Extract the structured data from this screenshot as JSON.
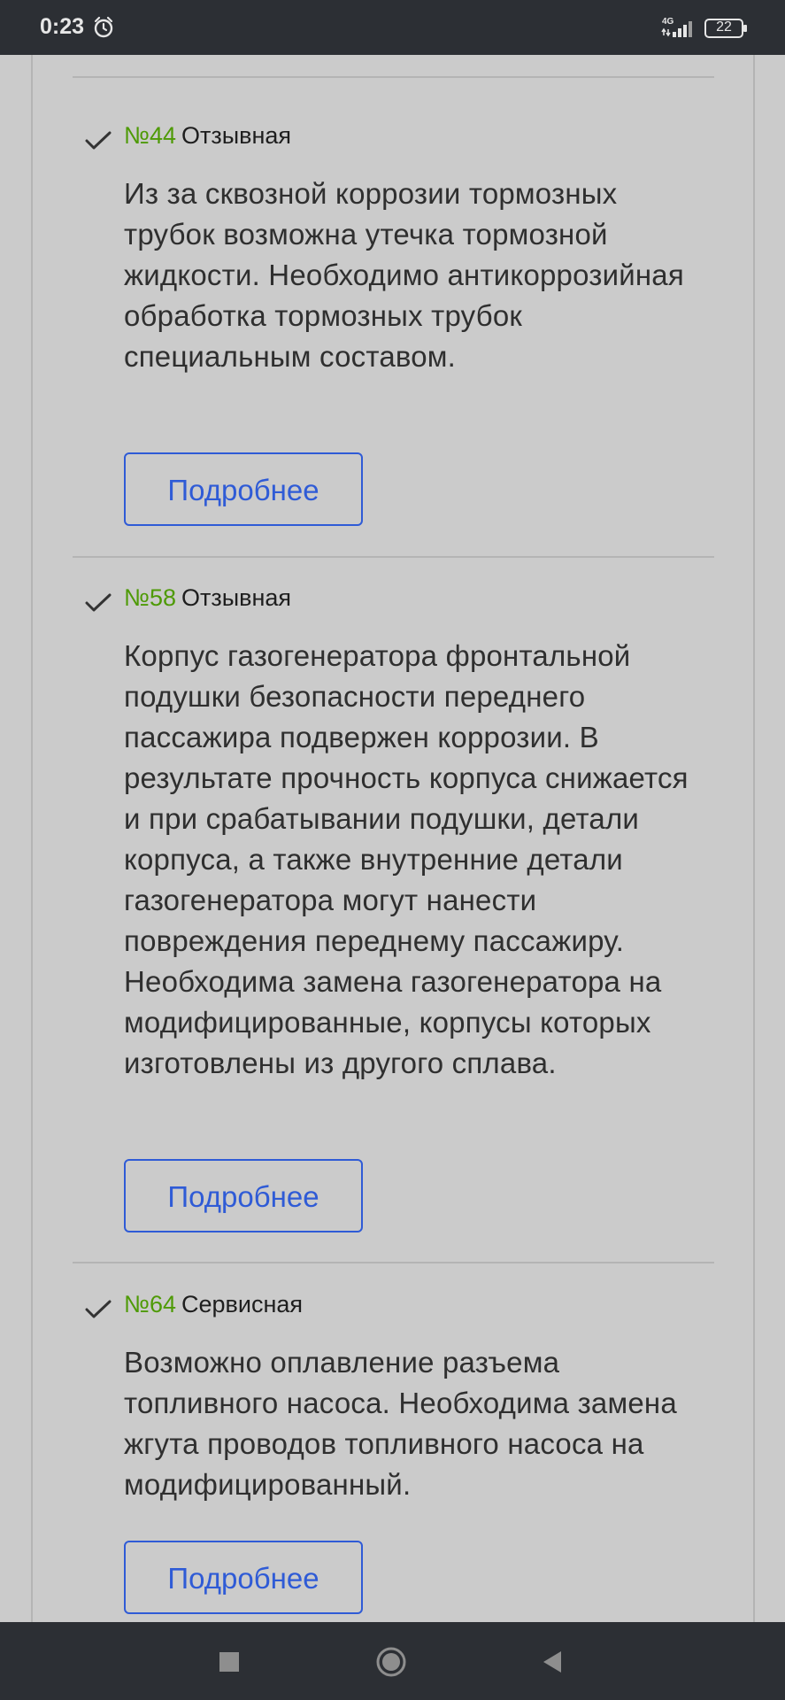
{
  "status_bar": {
    "time": "0:23",
    "network": "4G",
    "battery": "22",
    "icons": [
      "alarm-icon",
      "signal-icon",
      "battery-icon"
    ]
  },
  "items": [
    {
      "number": "№44",
      "type": "Отзывная",
      "text": "Из за сквозной коррозии тормозных трубок возможна утечка тормозной жидкости. Необходимо антикоррозийная обработка тормозных трубок специальным составом.",
      "button_label": "Подробнее"
    },
    {
      "number": "№58",
      "type": "Отзывная",
      "text": "Корпус газогенератора фронтальной подушки безопасности переднего пассажира подвержен коррозии. В результате прочность корпуса снижается и при срабатывании подушки, детали корпуса, а также внутренние детали газогенератора могут нанести повреждения переднему пассажиру. Необходима замена газогенератора на модифицированные, корпусы которых изготовлены из другого сплава.",
      "button_label": "Подробнее"
    },
    {
      "number": "№64",
      "type": "Сервисная",
      "text": "Возможно оплавление разъема топливного насоса. Необходима замена жгута проводов топливного насоса на модифицированный.",
      "button_label": "Подробнее"
    }
  ],
  "colors": {
    "background": "#cbcbcb",
    "number": "#4e9a06",
    "button": "#2f5bd6",
    "bars": "#2c2f34"
  },
  "nav_bar": {
    "icons": [
      "recents-square-icon",
      "home-circle-icon",
      "back-triangle-icon"
    ]
  }
}
